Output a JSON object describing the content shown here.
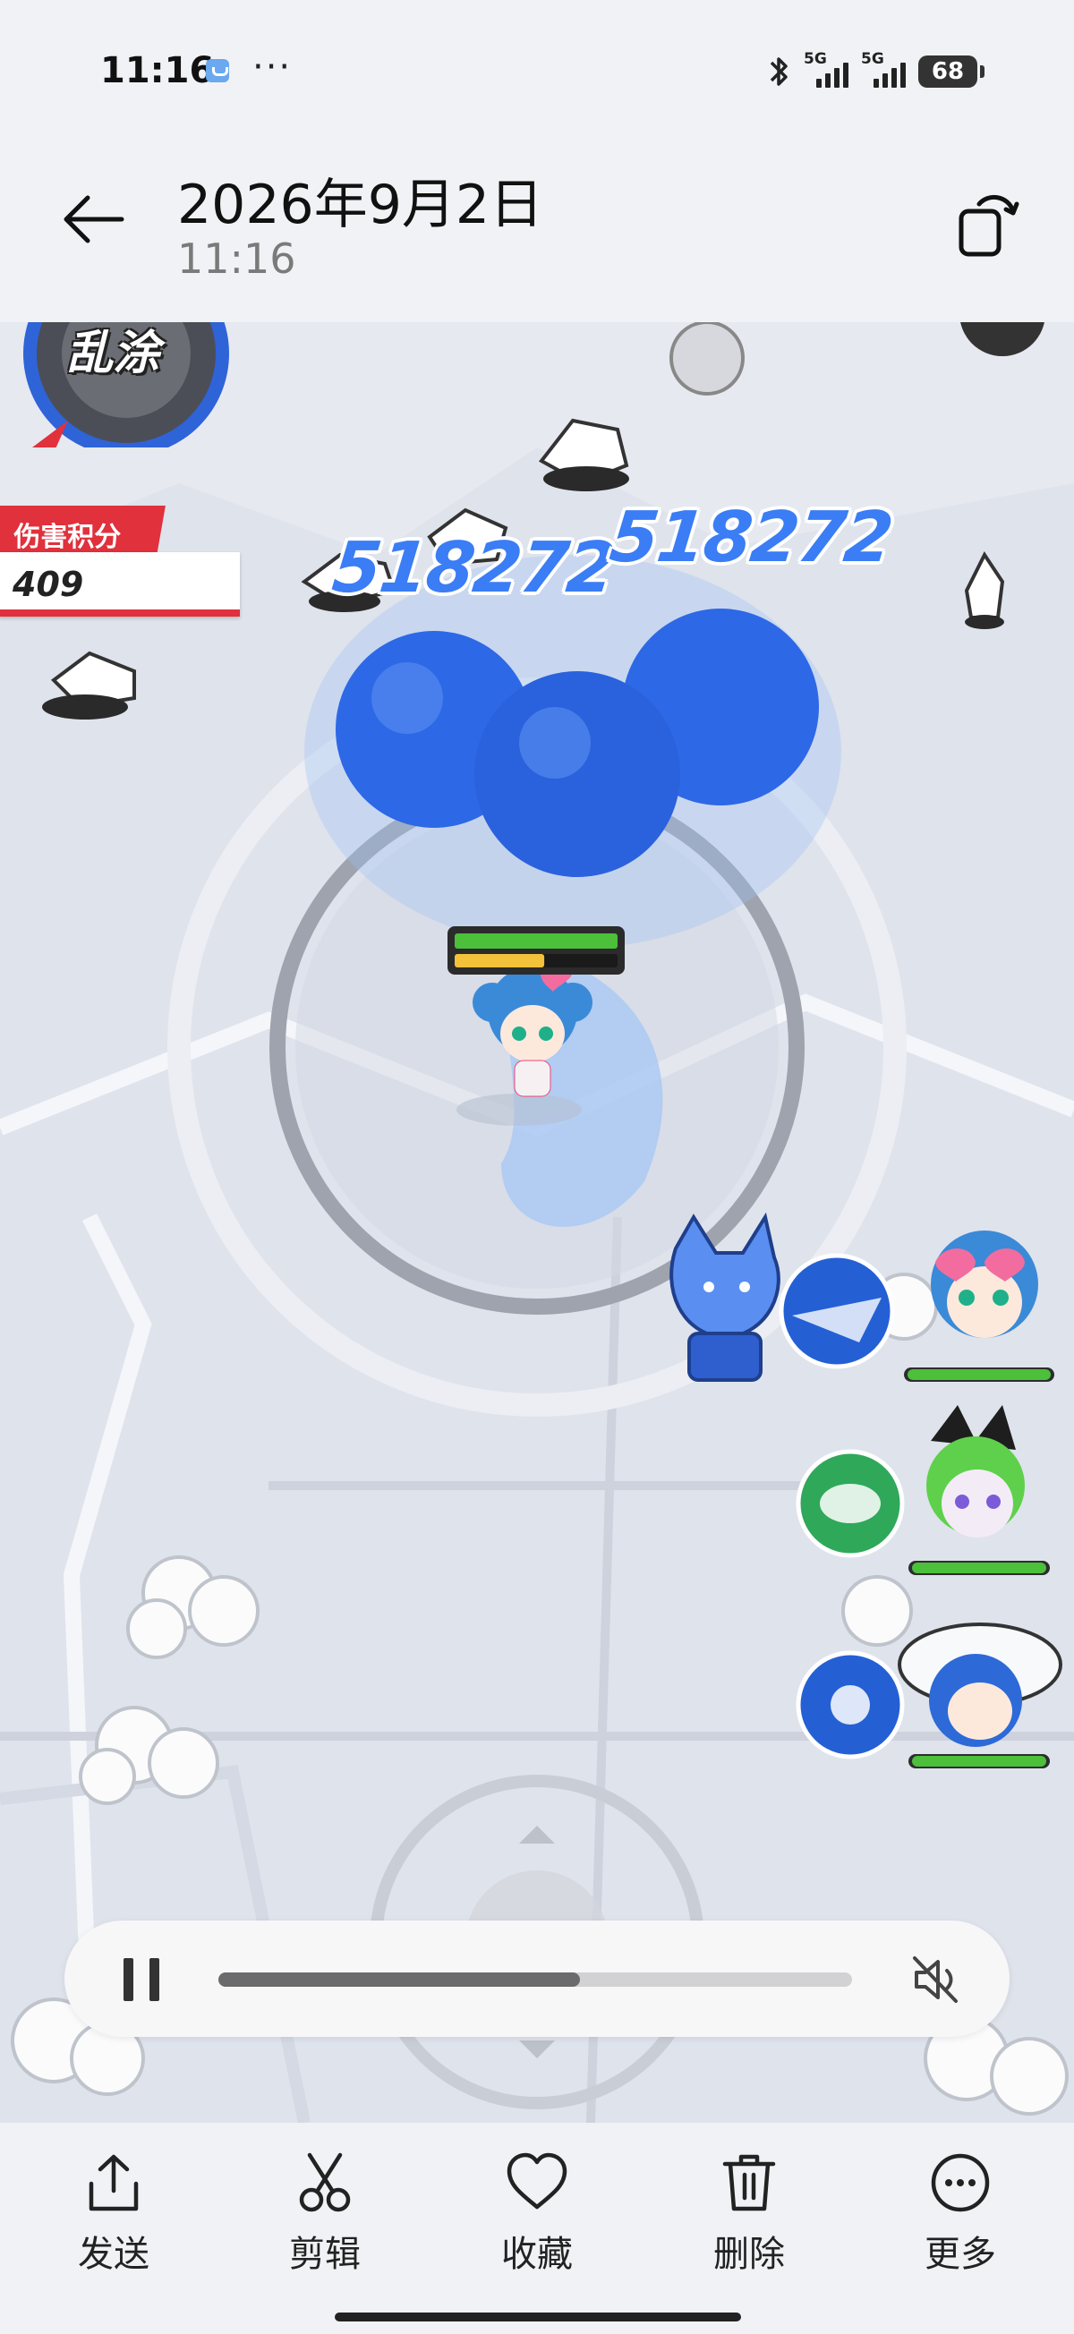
{
  "status_bar": {
    "time": "11:16",
    "more": "···",
    "battery": "68",
    "network_1": "5G",
    "network_2": "5G",
    "icons": [
      "bluetooth-icon",
      "signal-5g-icon",
      "signal-5g-icon",
      "battery-icon"
    ]
  },
  "header": {
    "title": "2026年9月2日",
    "subtitle": "11:16",
    "back_icon": "arrow-left-icon",
    "rotate_icon": "rotate-screen-icon"
  },
  "game": {
    "mode_badge": "乱涂",
    "score_label": "伤害积分",
    "score_value": "409",
    "damage_numbers": [
      "518272",
      "518272"
    ],
    "player_health": 1.0,
    "player_energy": 0.55,
    "accent_blue": "#3a7df5",
    "score_red": "#e0313c"
  },
  "playback": {
    "progress": 0.57,
    "pause_icon": "pause-icon",
    "mute_icon": "speaker-muted-icon"
  },
  "toolbar": {
    "send": "发送",
    "edit": "剪辑",
    "favorite": "收藏",
    "delete": "删除",
    "more": "更多"
  }
}
